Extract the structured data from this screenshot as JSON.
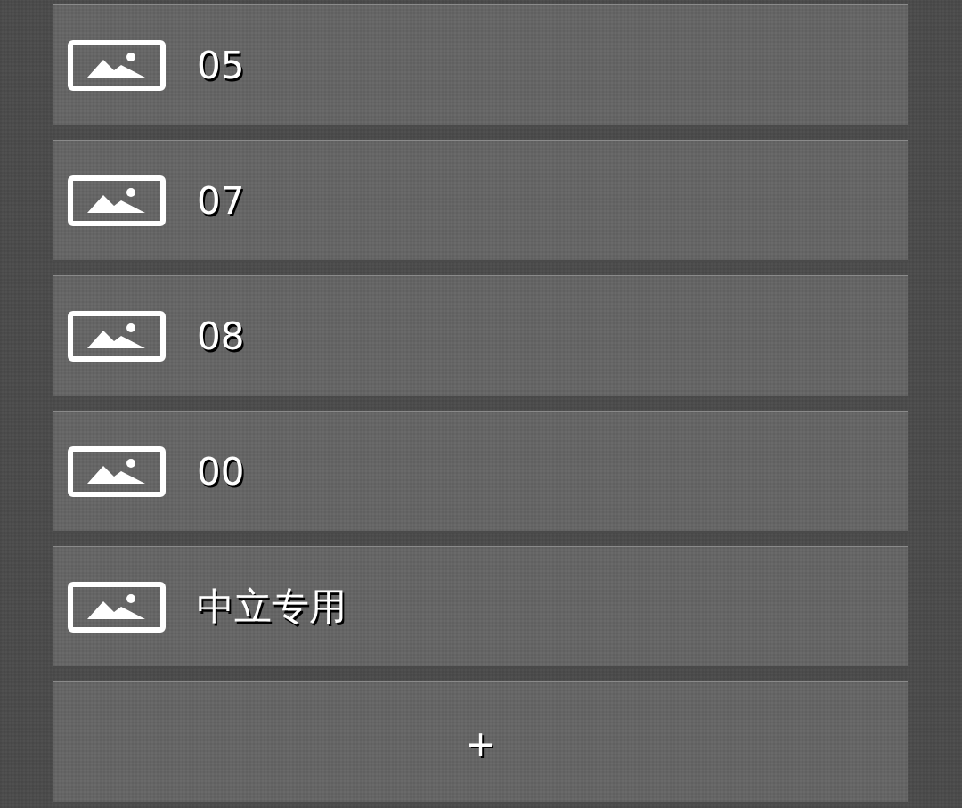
{
  "items": [
    {
      "label": "05"
    },
    {
      "label": "07"
    },
    {
      "label": "08"
    },
    {
      "label": "00"
    },
    {
      "label": "中立专用"
    }
  ],
  "add_button": {
    "label": "+"
  }
}
